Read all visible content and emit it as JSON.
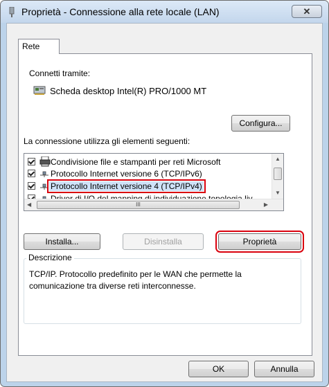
{
  "window": {
    "title": "Proprietà - Connessione alla rete locale (LAN)",
    "close_label": "✕"
  },
  "tab": {
    "label": "Rete"
  },
  "connect_via": {
    "label": "Connetti tramite:",
    "adapter_name": "Scheda desktop Intel(R) PRO/1000 MT",
    "configure_label": "Configura..."
  },
  "components": {
    "label": "La connessione utilizza gli elementi seguenti:",
    "items": [
      {
        "label": "Condivisione file e stampanti per reti Microsoft",
        "checked": true,
        "icon": "printer-share-icon",
        "selected": false
      },
      {
        "label": "Protocollo Internet versione 6 (TCP/IPv6)",
        "checked": true,
        "icon": "network-protocol-icon",
        "selected": false
      },
      {
        "label": "Protocollo Internet versione 4 (TCP/IPv4)",
        "checked": true,
        "icon": "network-protocol-icon",
        "selected": true
      },
      {
        "label": "Driver di I/O del mapping di individuazione topologia liv",
        "checked": true,
        "icon": "network-protocol-icon",
        "selected": false
      }
    ],
    "hscroll_thumb_glyph": "III"
  },
  "buttons": {
    "install": "Installa...",
    "uninstall": "Disinstalla",
    "properties": "Proprietà",
    "ok": "OK",
    "cancel": "Annulla"
  },
  "description": {
    "label": "Descrizione",
    "text": "TCP/IP. Protocollo predefinito per le WAN che permette la comunicazione tra diverse reti interconnesse."
  },
  "colors": {
    "highlight_border": "#d9000d",
    "selection_bg": "#cfe2f8",
    "title_bar": "#c3d6ec"
  }
}
